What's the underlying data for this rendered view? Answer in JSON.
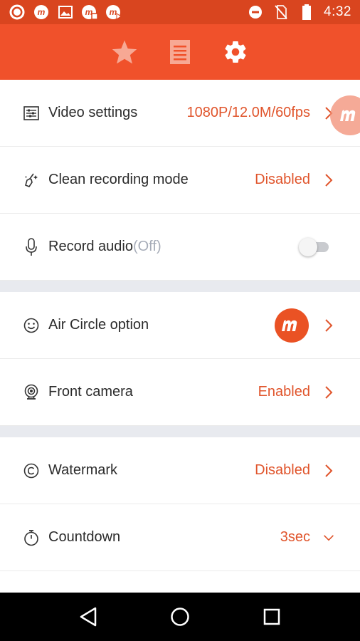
{
  "status_bar": {
    "time": "4:32",
    "left_icons": [
      "record-icon",
      "mobizen-icon",
      "image-icon",
      "mobizen-record-icon",
      "mobizen-play-icon"
    ],
    "right_icons": [
      "do-not-disturb-icon",
      "no-sim-icon",
      "battery-icon"
    ]
  },
  "app_bar": {
    "tabs": [
      "star-icon",
      "list-icon",
      "gear-icon"
    ],
    "active_tab": "gear-icon",
    "color": "#f0512b"
  },
  "settings": {
    "video": {
      "label": "Video settings",
      "value": "1080P/12.0M/60fps"
    },
    "clean": {
      "label": "Clean recording mode",
      "value": "Disabled"
    },
    "audio": {
      "label": "Record audio",
      "suffix": "(Off)",
      "toggle_on": false
    },
    "air_circle": {
      "label": "Air Circle option"
    },
    "front_camera": {
      "label": "Front camera",
      "value": "Enabled"
    },
    "watermark": {
      "label": "Watermark",
      "value": "Disabled"
    },
    "countdown": {
      "label": "Countdown",
      "value": "3sec"
    }
  },
  "colors": {
    "accent": "#e0542b",
    "status_bar": "#d9451f",
    "section_gap": "#e8eaef"
  }
}
